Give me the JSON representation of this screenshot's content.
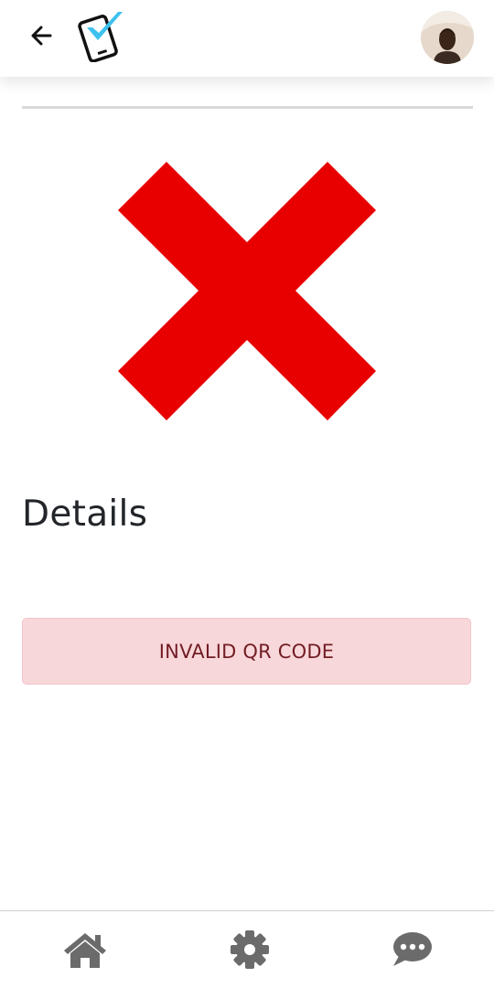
{
  "header": {
    "back_icon": "arrow-left-icon",
    "logo_icon": "phone-check-logo",
    "avatar_icon": "user-avatar"
  },
  "result": {
    "status_icon": "red-x-icon",
    "status_color": "#e80000"
  },
  "details": {
    "heading": "Details"
  },
  "alert": {
    "message": "INVALID QR CODE",
    "background": "#f8d7da",
    "text_color": "#721c24"
  },
  "bottom_nav": {
    "items": [
      {
        "icon": "home-icon"
      },
      {
        "icon": "gear-icon"
      },
      {
        "icon": "chat-bubble-icon"
      }
    ],
    "icon_color": "#6b6b6b"
  }
}
